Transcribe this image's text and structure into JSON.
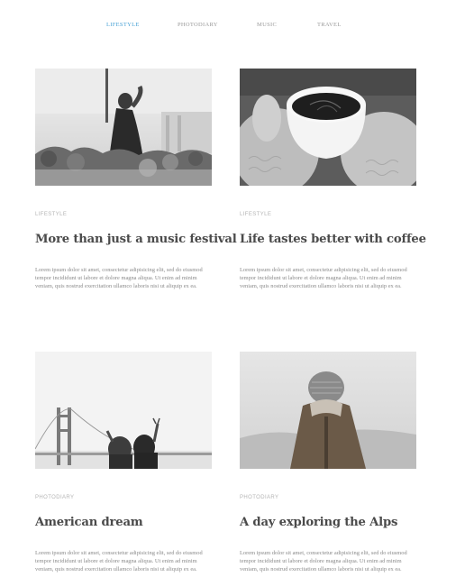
{
  "nav": {
    "items": [
      "LIFESTYLE",
      "PHOTODIARY",
      "MUSIC",
      "TRAVEL"
    ],
    "active_index": 0
  },
  "colors": {
    "accent": "#4aa3d6",
    "muted": "#9a9a9a",
    "title": "#4a4a4a",
    "body_text": "#8a8a8a"
  },
  "posts": [
    {
      "category": "LIFESTYLE",
      "title": "More than just a music festival",
      "excerpt": "Lorem ipsum dolor sit amet, consectetur adipisicing elit, sed do eiusmod tempor incididunt ut labore et dolore magna aliqua. Ut enim ad minim veniam, quis nostrud exercitation ullamco laboris nisi ut aliquip ex ea.",
      "image": "concert-crowd-photo"
    },
    {
      "category": "LIFESTYLE",
      "title": "Life tastes better with coffee",
      "excerpt": "Lorem ipsum dolor sit amet, consectetur adipisicing elit, sed do eiusmod tempor incididunt ut labore et dolore magna aliqua. Ut enim ad minim veniam, quis nostrud exercitation ullamco laboris nisi ut aliquip ex ea.",
      "image": "coffee-cup-hands-photo"
    },
    {
      "category": "PHOTODIARY",
      "title": "American dream",
      "excerpt": "Lorem ipsum dolor sit amet, consectetur adipisicing elit, sed do eiusmod tempor incididunt ut labore et dolore magna aliqua. Ut enim ad minim veniam, quis nostrud exercitation ullamco laboris nisi ut aliquip ex ea.",
      "image": "golden-gate-bridge-photo"
    },
    {
      "category": "PHOTODIARY",
      "title": "A day exploring the Alps",
      "excerpt": "Lorem ipsum dolor sit amet, consectetur adipisicing elit, sed do eiusmod tempor incididunt ut labore et dolore magna aliqua. Ut enim ad minim veniam, quis nostrud exercitation ullamco laboris nisi ut aliquip ex ea.",
      "image": "hiker-beanie-photo"
    }
  ]
}
